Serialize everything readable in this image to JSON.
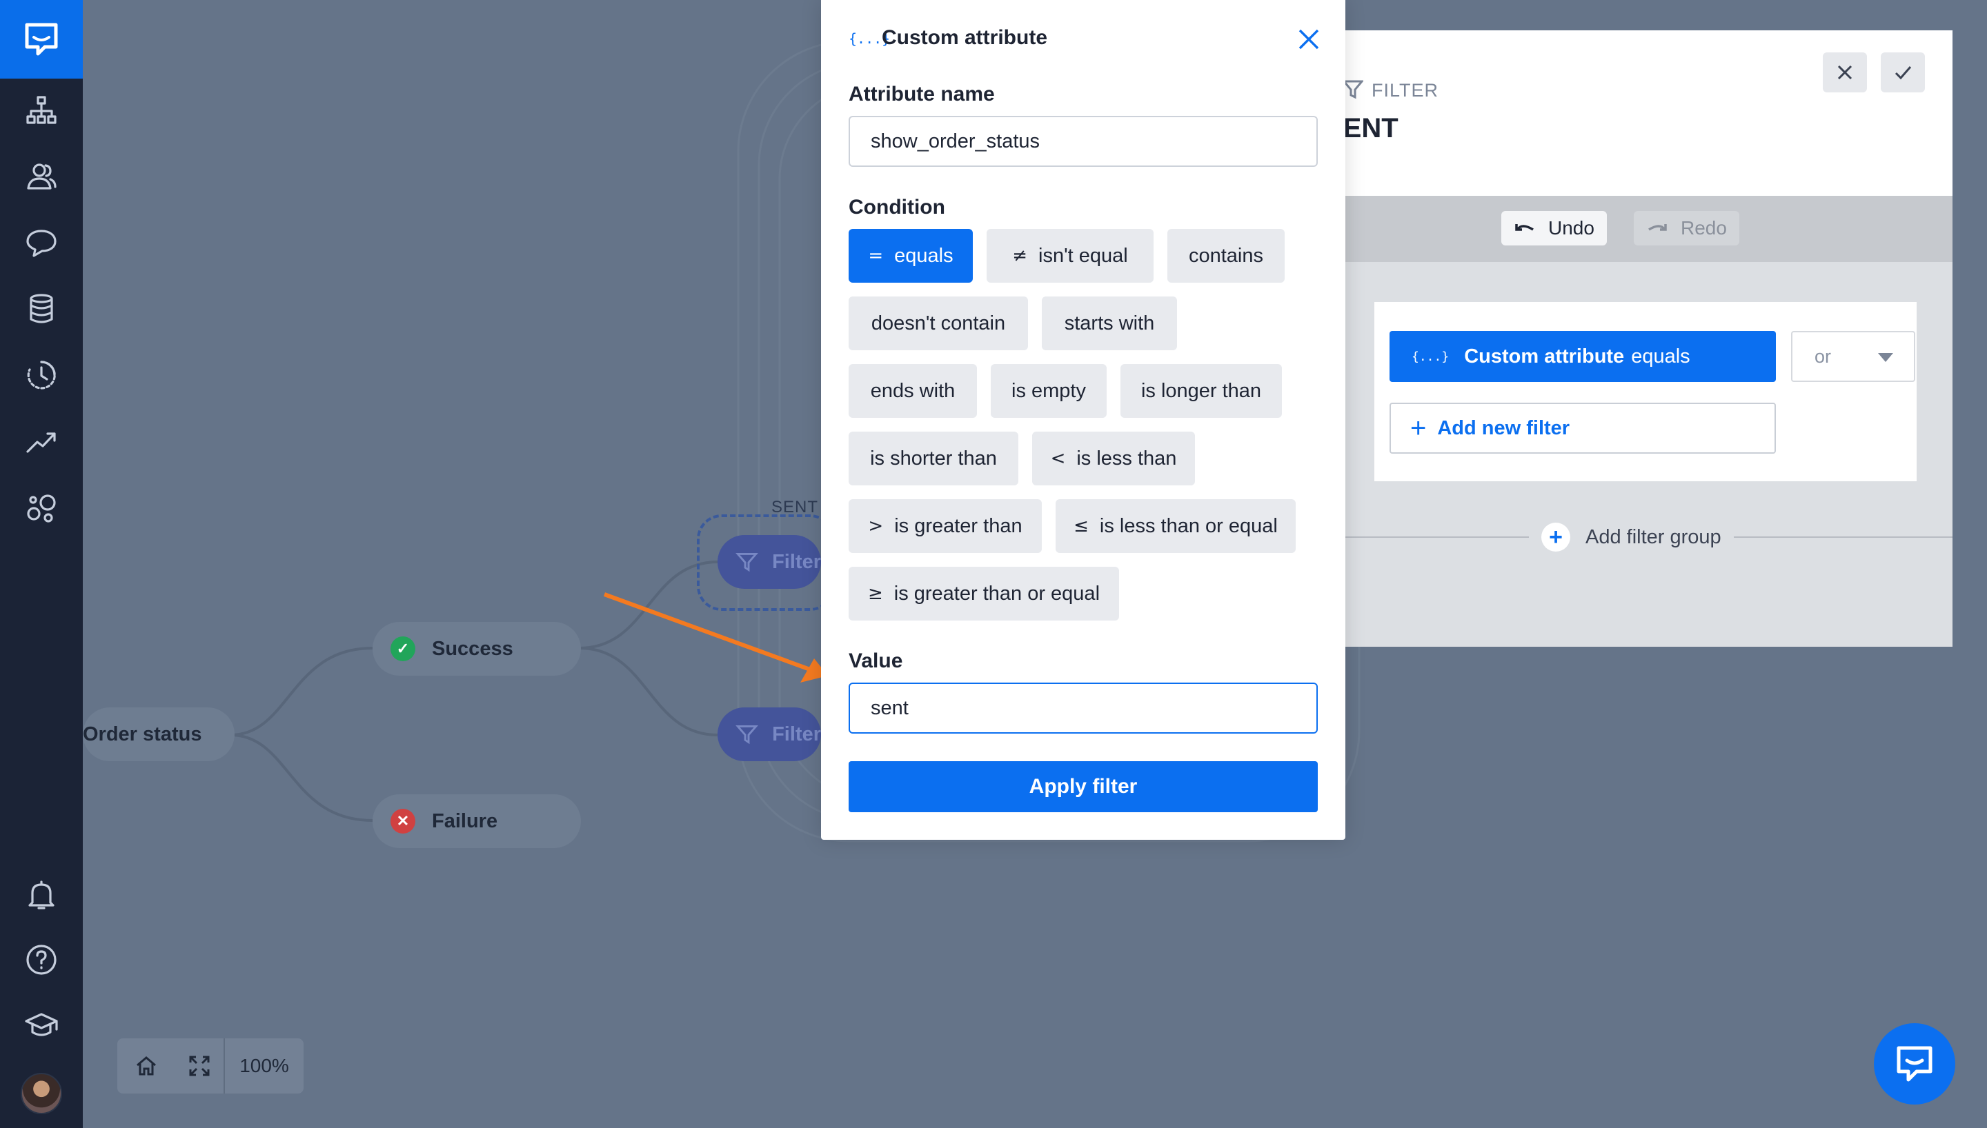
{
  "sidebar": {
    "icons": [
      "chat-logo-icon",
      "bot-flows-icon",
      "users-icon",
      "chat-bubble-icon",
      "database-icon",
      "history-icon",
      "analytics-icon",
      "integrations-icon",
      "bell-icon",
      "help-icon",
      "academy-icon"
    ]
  },
  "canvas": {
    "nodes": {
      "order_status": "Order status",
      "success": "Success",
      "failure": "Failure",
      "filter_top": "Filter",
      "filter_bottom": "Filter",
      "sent_label": "SENT"
    },
    "zoom": "100%"
  },
  "panel": {
    "filter_label": "FILTER",
    "title": "SENT",
    "undo_label": "Undo",
    "redo_label": "Redo",
    "active_filter_label": "Custom attribute",
    "active_filter_condition": "equals",
    "or_select_value": "or",
    "add_filter_label": "Add new filter",
    "add_group_label": "Add filter group"
  },
  "modal": {
    "title": "Custom attribute",
    "attribute_name_label": "Attribute name",
    "attribute_name_value": "show_order_status",
    "condition_label": "Condition",
    "conditions": [
      {
        "symbol": "=",
        "label": "equals",
        "active": true
      },
      {
        "symbol": "≠",
        "label": "isn't equal"
      },
      {
        "symbol": "",
        "label": "contains"
      },
      {
        "symbol": "",
        "label": "doesn't contain"
      },
      {
        "symbol": "",
        "label": "starts with"
      },
      {
        "symbol": "",
        "label": "ends with"
      },
      {
        "symbol": "",
        "label": "is empty"
      },
      {
        "symbol": "",
        "label": "is longer than"
      },
      {
        "symbol": "",
        "label": "is shorter than"
      },
      {
        "symbol": "<",
        "label": "is less than"
      },
      {
        "symbol": ">",
        "label": "is greater than"
      },
      {
        "symbol": "≤",
        "label": "is less than or equal"
      },
      {
        "symbol": "≥",
        "label": "is greater than or equal"
      }
    ],
    "value_label": "Value",
    "value": "sent",
    "apply_label": "Apply filter"
  },
  "colors": {
    "accent": "#0b6ff0",
    "sidebar": "#1b2336",
    "overlay_bg": "#657489",
    "arrow": "#f47a20"
  }
}
